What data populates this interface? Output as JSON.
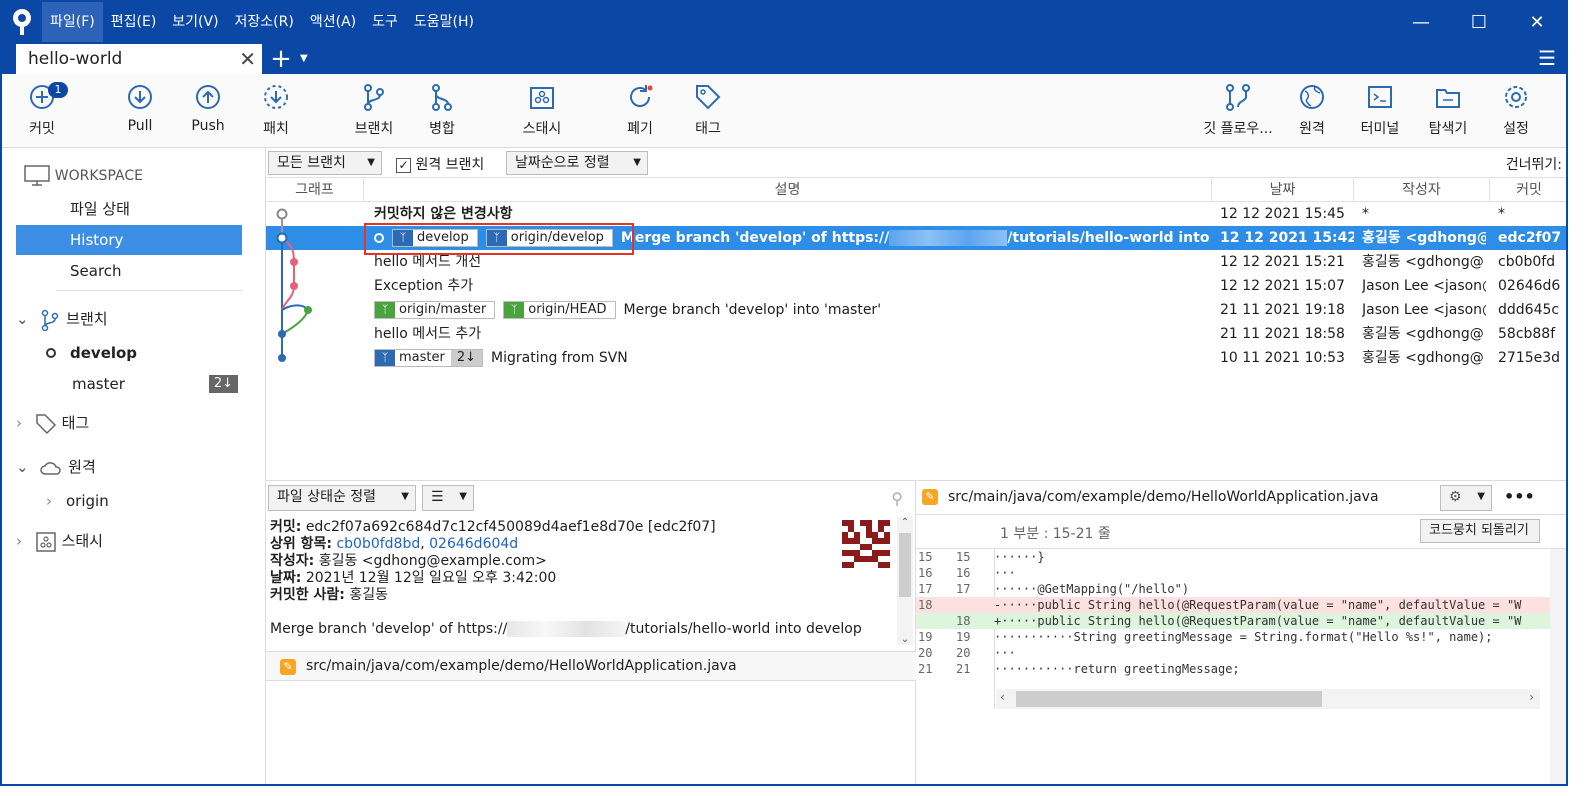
{
  "menu": {
    "items": [
      "파일(F)",
      "편집(E)",
      "보기(V)",
      "저장소(R)",
      "액션(A)",
      "도구",
      "도움말(H)"
    ]
  },
  "tab": {
    "title": "hello-world"
  },
  "toolbar": {
    "commit": "커밋",
    "commit_badge": "1",
    "pull": "Pull",
    "push": "Push",
    "fetch": "패치",
    "branch": "브랜치",
    "merge": "병합",
    "stash": "스태시",
    "discard": "폐기",
    "tag": "태그",
    "gitflow": "깃 플로우...",
    "remote": "원격",
    "terminal": "터미널",
    "explorer": "탐색기",
    "settings": "설정"
  },
  "sidebar": {
    "workspace": "WORKSPACE",
    "file_status": "파일 상태",
    "history": "History",
    "search": "Search",
    "branches_header": "브랜치",
    "branch_develop": "develop",
    "branch_master": "master",
    "master_badge": "2↓",
    "tags_header": "태그",
    "remotes_header": "원격",
    "remote_origin": "origin",
    "stash_header": "스태시"
  },
  "filter": {
    "branch_select": "모든 브랜치",
    "remote_checkbox": "원격 브랜치",
    "sort_select": "날짜순으로 정렬",
    "skip": "건너뛰기:"
  },
  "columns": {
    "graph": "그래프",
    "desc": "설명",
    "date": "날짜",
    "author": "작성자",
    "commit": "커밋"
  },
  "commits": [
    {
      "desc": "커밋하지 않은 변경사항",
      "date": "12 12 2021 15:45",
      "author": "*",
      "hash": "*"
    },
    {
      "tags": [
        "develop",
        "origin/develop"
      ],
      "desc_a": "Merge branch 'develop' of https://",
      "desc_b": "/tutorials/hello-world into d",
      "date": "12 12 2021 15:42",
      "author": "홍길동 <gdhong@",
      "hash": "edc2f07"
    },
    {
      "desc": "hello 메서드 개선",
      "date": "12 12 2021 15:21",
      "author": "홍길동 <gdhong@",
      "hash": "cb0b0fd"
    },
    {
      "desc": "Exception 추가",
      "date": "12 12 2021 15:07",
      "author": "Jason Lee <jason@",
      "hash": "02646d6"
    },
    {
      "tags": [
        "origin/master",
        "origin/HEAD"
      ],
      "desc": "Merge branch 'develop' into 'master'",
      "date": "21 11 2021 19:18",
      "author": "Jason Lee <jason@",
      "hash": "ddd645c"
    },
    {
      "desc": "hello 메서드 추가",
      "date": "21 11 2021 18:58",
      "author": "홍길동 <gdhong@",
      "hash": "58cb88f"
    },
    {
      "tags": [
        "master"
      ],
      "tag_count": "2↓",
      "desc": "Migrating from SVN",
      "date": "10 11 2021 10:53",
      "author": "홍길동 <gdhong@",
      "hash": "2715e3d"
    }
  ],
  "details": {
    "sort_select": "파일 상태순 정렬",
    "commit_label": "커밋:",
    "commit_value": "edc2f07a692c684d7c12cf450089d4aef1e8d70e [edc2f07]",
    "parents_label": "상위 항목:",
    "parent1": "cb0b0fd8bd",
    "parent_sep": ", ",
    "parent2": "02646d604d",
    "author_label": "작성자:",
    "author_value": "홍길동 <gdhong@example.com>",
    "date_label": "날짜:",
    "date_value": "2021년 12월 12일 일요일 오후 3:42:00",
    "committer_label": "커밋한 사람:",
    "committer_value": "홍길동",
    "message_a": "Merge branch 'develop' of https://",
    "message_b": "/tutorials/hello-world into develop",
    "file": "src/main/java/com/example/demo/HelloWorldApplication.java"
  },
  "diff": {
    "file": "src/main/java/com/example/demo/HelloWorldApplication.java",
    "hunk": "1 부분 : 15-21 줄",
    "revert": "코드뭉치 되돌리기",
    "lines": [
      {
        "n1": "15",
        "n2": "15",
        "type": "ctx",
        "text": "······}"
      },
      {
        "n1": "16",
        "n2": "16",
        "type": "ctx",
        "text": "···"
      },
      {
        "n1": "17",
        "n2": "17",
        "type": "ctx",
        "text": "······@GetMapping(\"/hello\")"
      },
      {
        "n1": "18",
        "n2": "",
        "type": "del",
        "text": "-·····public String hello(@RequestParam(value = \"name\", defaultValue = \"W"
      },
      {
        "n1": "",
        "n2": "18",
        "type": "add",
        "text": "+·····public String hello(@RequestParam(value = \"name\", defaultValue = \"W"
      },
      {
        "n1": "19",
        "n2": "19",
        "type": "ctx",
        "text": "···········String greetingMessage = String.format(\"Hello %s!\", name);"
      },
      {
        "n1": "20",
        "n2": "20",
        "type": "ctx",
        "text": "···"
      },
      {
        "n1": "21",
        "n2": "21",
        "type": "ctx",
        "text": "···········return greetingMessage;"
      }
    ]
  },
  "colors": {
    "accent": "#0b47a4",
    "selection": "#2e8de6",
    "sidebar_selection": "#3d8fe6",
    "highlight_box": "#e0352b"
  }
}
